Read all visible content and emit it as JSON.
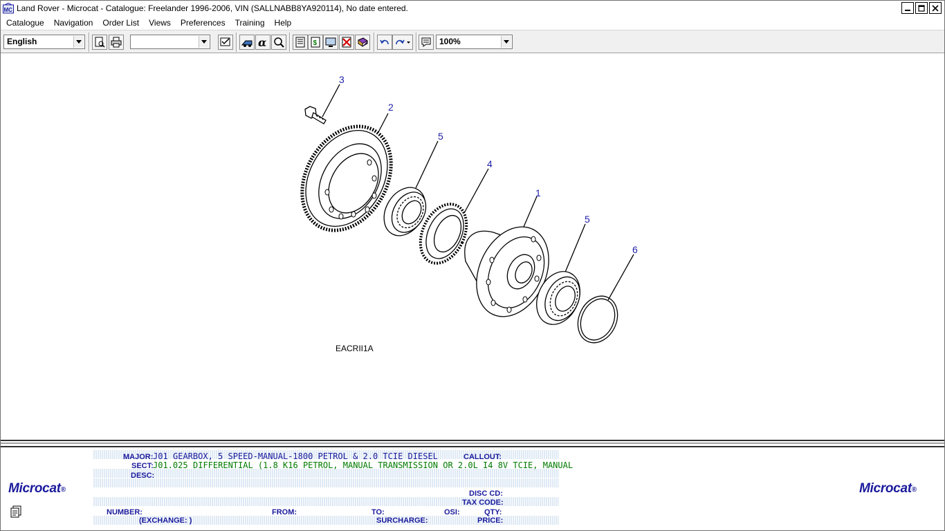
{
  "window": {
    "title": "Land Rover - Microcat - Catalogue: Freelander 1996-2006, VIN (SALLNABB8YA920114), No date entered."
  },
  "menu": [
    "Catalogue",
    "Navigation",
    "Order List",
    "Views",
    "Preferences",
    "Training",
    "Help"
  ],
  "toolbar": {
    "language": "English",
    "blank_select": "",
    "zoom": "100%",
    "icons": [
      "print-preview-icon",
      "print-icon",
      "checklist-icon",
      "search-vin-icon",
      "alpha-search-icon",
      "magnifier-icon",
      "catalogue-icon",
      "order-icon",
      "screen-icon",
      "delete-icon",
      "book-icon",
      "undo-icon",
      "redo-icon",
      "notes-icon"
    ]
  },
  "illustration": {
    "code": "EACRII1A",
    "callouts": [
      "3",
      "2",
      "5",
      "4",
      "1",
      "5",
      "6"
    ]
  },
  "info": {
    "logo": "Microcat",
    "logo_mark": "®",
    "labels": {
      "major": "MAJOR:",
      "sect": "SECT:",
      "desc": "DESC:",
      "callout": "CALLOUT:",
      "disc_cd": "DISC CD:",
      "tax_code": "TAX CODE:",
      "number": "NUMBER:",
      "from": "FROM:",
      "to": "TO:",
      "osi": "OSI:",
      "qty": "QTY:",
      "exchange": "(EXCHANGE:  )",
      "surcharge": "SURCHARGE:",
      "price": "PRICE:"
    },
    "major_code": "J01",
    "major_desc": "GEARBOX, 5 SPEED-MANUAL-1800 PETROL & 2.0 TCIE DIESEL",
    "sect_code": "J01.025",
    "sect_desc": "DIFFERENTIAL (1.8 K16 PETROL, MANUAL TRANSMISSION OR 2.0L I4 8V TCIE, MANUAL"
  }
}
